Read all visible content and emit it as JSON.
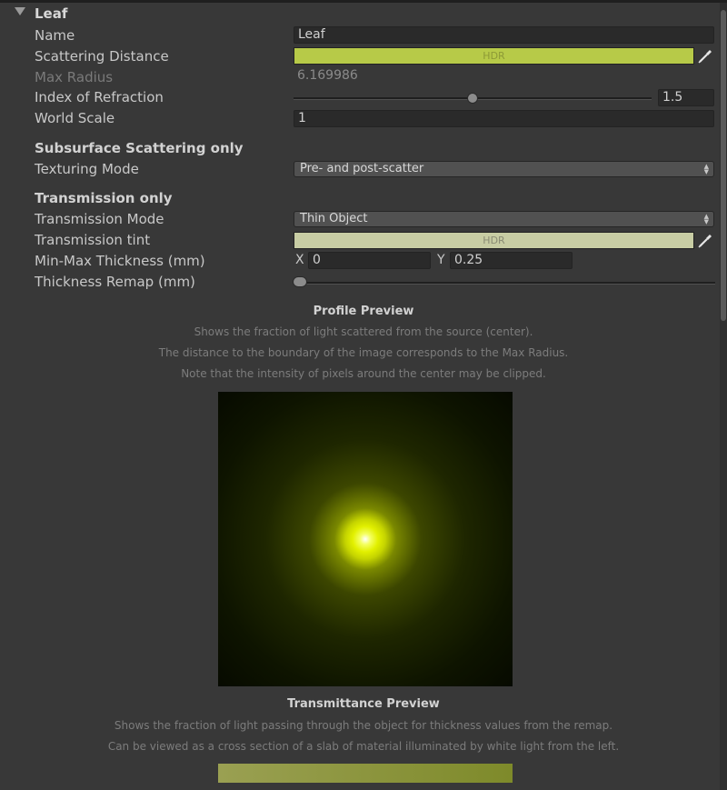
{
  "header": {
    "title": "Leaf"
  },
  "fields": {
    "name": {
      "label": "Name",
      "value": "Leaf"
    },
    "scattering_distance": {
      "label": "Scattering Distance",
      "badge": "HDR",
      "color": "#b7ca48"
    },
    "max_radius": {
      "label": "Max Radius",
      "value": "6.169986"
    },
    "index_of_refraction": {
      "label": "Index of Refraction",
      "value": "1.5",
      "slider_fraction": 0.5
    },
    "world_scale": {
      "label": "World Scale",
      "value": "1"
    }
  },
  "sss_section": {
    "title": "Subsurface Scattering only",
    "texturing_mode": {
      "label": "Texturing Mode",
      "value": "Pre- and post-scatter"
    }
  },
  "transmission_section": {
    "title": "Transmission only",
    "transmission_mode": {
      "label": "Transmission Mode",
      "value": "Thin Object"
    },
    "transmission_tint": {
      "label": "Transmission tint",
      "badge": "HDR",
      "color": "#c8cda4"
    },
    "min_max_thickness": {
      "label": "Min-Max Thickness (mm)",
      "x_label": "X",
      "x_value": "0",
      "y_label": "Y",
      "y_value": "0.25"
    },
    "thickness_remap": {
      "label": "Thickness Remap (mm)"
    }
  },
  "profile_preview": {
    "title": "Profile Preview",
    "notes": [
      "Shows the fraction of light scattered from the source (center).",
      "The distance to the boundary of the image corresponds to the Max Radius.",
      "Note that the intensity of pixels around the center may be clipped."
    ]
  },
  "transmittance_preview": {
    "title": "Transmittance Preview",
    "notes": [
      "Shows the fraction of light passing through the object for thickness values from the remap.",
      "Can be viewed as a cross section of a slab of material illuminated by white light from the left."
    ]
  }
}
